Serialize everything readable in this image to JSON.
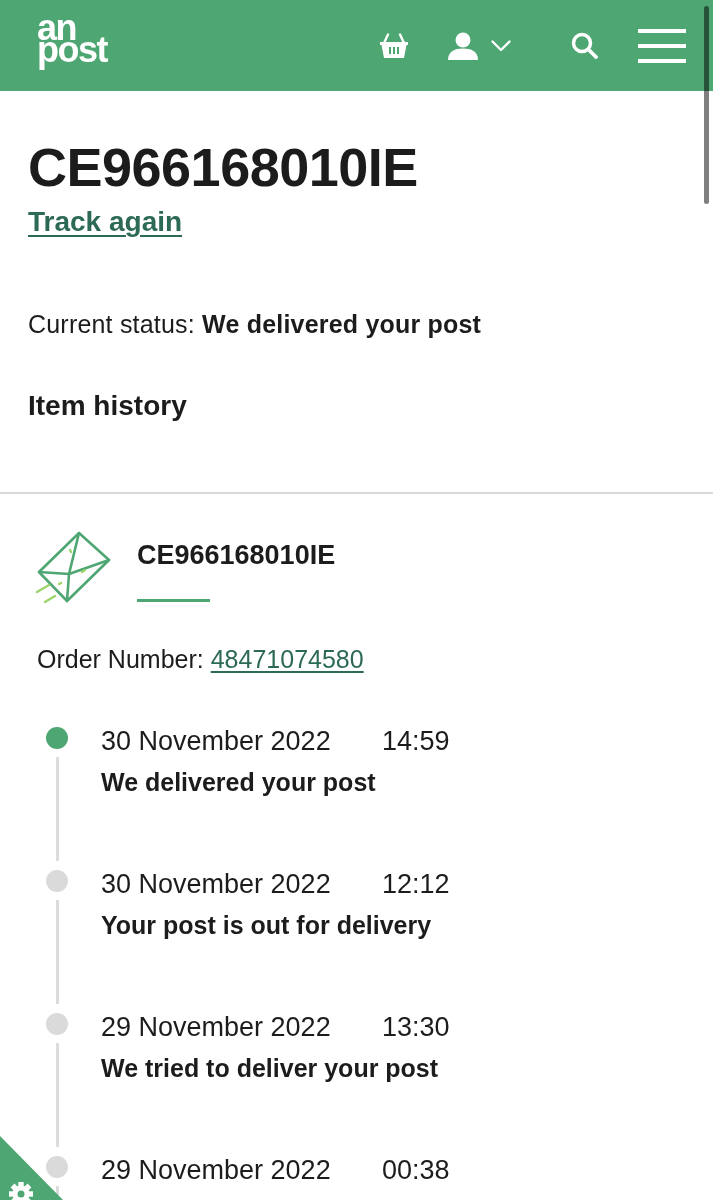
{
  "header": {
    "logo": [
      "an",
      "post"
    ]
  },
  "tracking": {
    "number": "CE966168010IE",
    "track_again": "Track again",
    "current_status": "Current status: **We delivered your post**",
    "section_title": "Item history"
  },
  "item": {
    "number": "CE966168010IE",
    "order_label": "Order Number:",
    "order_number": "48471074580"
  },
  "events": [
    {
      "date": "30 November 2022",
      "time": "14:59",
      "description": "We delivered your post",
      "current": true
    },
    {
      "date": "30 November 2022",
      "time": "12:12",
      "description": "Your post is out for delivery",
      "current": false
    },
    {
      "date": "29 November 2022",
      "time": "13:30",
      "description": "We tried to deliver your post",
      "current": false
    },
    {
      "date": "29 November 2022",
      "time": "00:38",
      "current": false
    }
  ]
}
